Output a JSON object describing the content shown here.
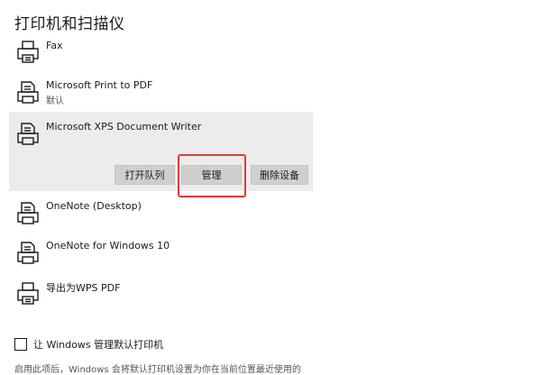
{
  "page": {
    "title": "打印机和扫描仪"
  },
  "devices": [
    {
      "name": "Fax",
      "status": ""
    },
    {
      "name": "Microsoft Print to PDF",
      "status": "默认"
    },
    {
      "name": "Microsoft XPS Document Writer",
      "status": ""
    },
    {
      "name": "OneNote (Desktop)",
      "status": ""
    },
    {
      "name": "OneNote for Windows 10",
      "status": ""
    },
    {
      "name": "导出为WPS PDF",
      "status": ""
    }
  ],
  "actions": {
    "open_queue": "打开队列",
    "manage": "管理",
    "remove_device": "删除设备"
  },
  "settings": {
    "default_printer_checkbox_label": "让 Windows 管理默认打印机",
    "default_printer_description": "启用此项后，Windows 会将默认打印机设置为你在当前位置最近使用的"
  },
  "colors": {
    "highlight_border": "#e53935",
    "selected_background": "#ececec",
    "button_background": "#cfcfcf"
  }
}
